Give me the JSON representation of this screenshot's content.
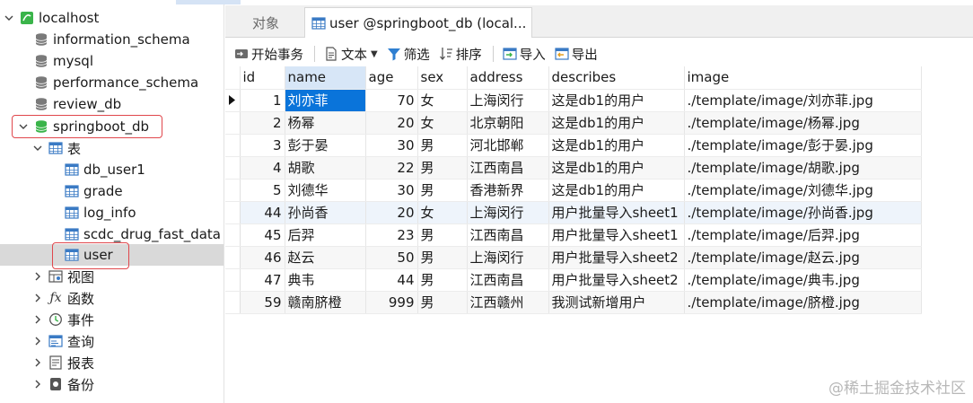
{
  "sidebar": {
    "connection": "localhost",
    "databases": [
      "information_schema",
      "mysql",
      "performance_schema",
      "review_db",
      "springboot_db"
    ],
    "tables_group": "表",
    "tables": [
      "db_user1",
      "grade",
      "log_info",
      "scdc_drug_fast_data",
      "user"
    ],
    "groups": [
      "视图",
      "函数",
      "事件",
      "查询",
      "报表",
      "备份"
    ]
  },
  "tabs": {
    "objects": "对象",
    "active": "user @springboot_db (local..."
  },
  "toolbar": {
    "begin_tx": "开始事务",
    "text": "文本",
    "filter": "筛选",
    "sort": "排序",
    "import": "导入",
    "export": "导出"
  },
  "grid": {
    "columns": [
      "id",
      "name",
      "age",
      "sex",
      "address",
      "describes",
      "image"
    ],
    "rows": [
      [
        "1",
        "刘亦菲",
        "70",
        "女",
        "上海闵行",
        "这是db1的用户",
        "./template/image/刘亦菲.jpg"
      ],
      [
        "2",
        "杨幂",
        "20",
        "女",
        "北京朝阳",
        "这是db1的用户",
        "./template/image/杨幂.jpg"
      ],
      [
        "3",
        "彭于晏",
        "30",
        "男",
        "河北邯郸",
        "这是db1的用户",
        "./template/image/彭于晏.jpg"
      ],
      [
        "4",
        "胡歌",
        "22",
        "男",
        "江西南昌",
        "这是db1的用户",
        "./template/image/胡歌.jpg"
      ],
      [
        "5",
        "刘德华",
        "30",
        "男",
        "香港新界",
        "这是db1的用户",
        "./template/image/刘德华.jpg"
      ],
      [
        "44",
        "孙尚香",
        "20",
        "女",
        "上海闵行",
        "用户批量导入sheet1",
        "./template/image/孙尚香.jpg"
      ],
      [
        "45",
        "后羿",
        "23",
        "男",
        "江西南昌",
        "用户批量导入sheet1",
        "./template/image/后羿.jpg"
      ],
      [
        "46",
        "赵云",
        "50",
        "男",
        "上海闵行",
        "用户批量导入sheet2",
        "./template/image/赵云.jpg"
      ],
      [
        "47",
        "典韦",
        "44",
        "男",
        "江西南昌",
        "用户批量导入sheet2",
        "./template/image/典韦.jpg"
      ],
      [
        "59",
        "赣南脐橙",
        "999",
        "男",
        "江西赣州",
        "我测试新增用户",
        "./template/image/脐橙.jpg"
      ]
    ]
  },
  "watermark": "@稀土掘金技术社区",
  "colors": {
    "selection": "#0a74da",
    "highlight_box": "#e0474c",
    "db_green": "#3ab44a"
  }
}
